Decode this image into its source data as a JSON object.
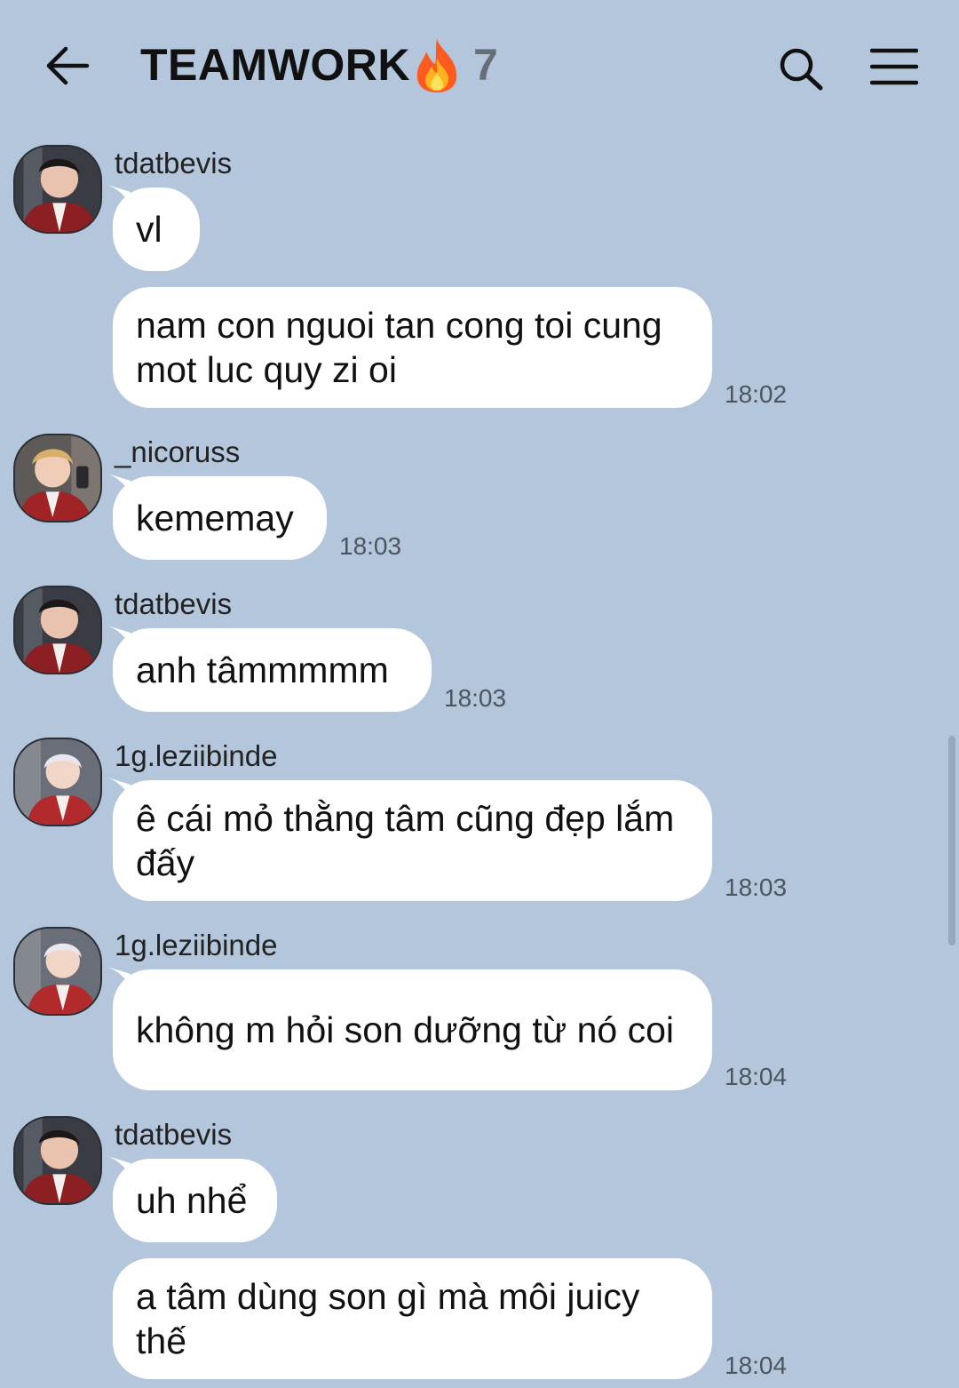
{
  "header": {
    "title": "TEAMWORK",
    "member_count": "7",
    "icons": [
      "back-arrow-icon",
      "fire-emoji-icon",
      "search-icon",
      "hamburger-menu-icon"
    ]
  },
  "colors": {
    "background": "#b3c6db",
    "bubble": "#ffffff",
    "accent_fire": "#ff6a1a"
  },
  "messages": [
    {
      "sender": "tdatbevis",
      "texts": [
        "vl",
        "nam con nguoi tan cong toi cung mot luc quy zi oi"
      ],
      "time": "18:02"
    },
    {
      "sender": "_nicoruss",
      "texts": [
        "kememay"
      ],
      "time": "18:03"
    },
    {
      "sender": "tdatbevis",
      "texts": [
        "anh tâmmmmm"
      ],
      "time": "18:03"
    },
    {
      "sender": "1g.leziibinde",
      "texts": [
        "ê cái mỏ thằng tâm cũng đẹp lắm đấy"
      ],
      "time": "18:03"
    },
    {
      "sender": "1g.leziibinde",
      "texts": [
        "không m hỏi son dưỡng từ nó coi"
      ],
      "time": "18:04"
    },
    {
      "sender": "tdatbevis",
      "texts": [
        "uh nhể",
        "a tâm dùng son gì mà môi juicy thế"
      ],
      "time": "18:04"
    }
  ]
}
